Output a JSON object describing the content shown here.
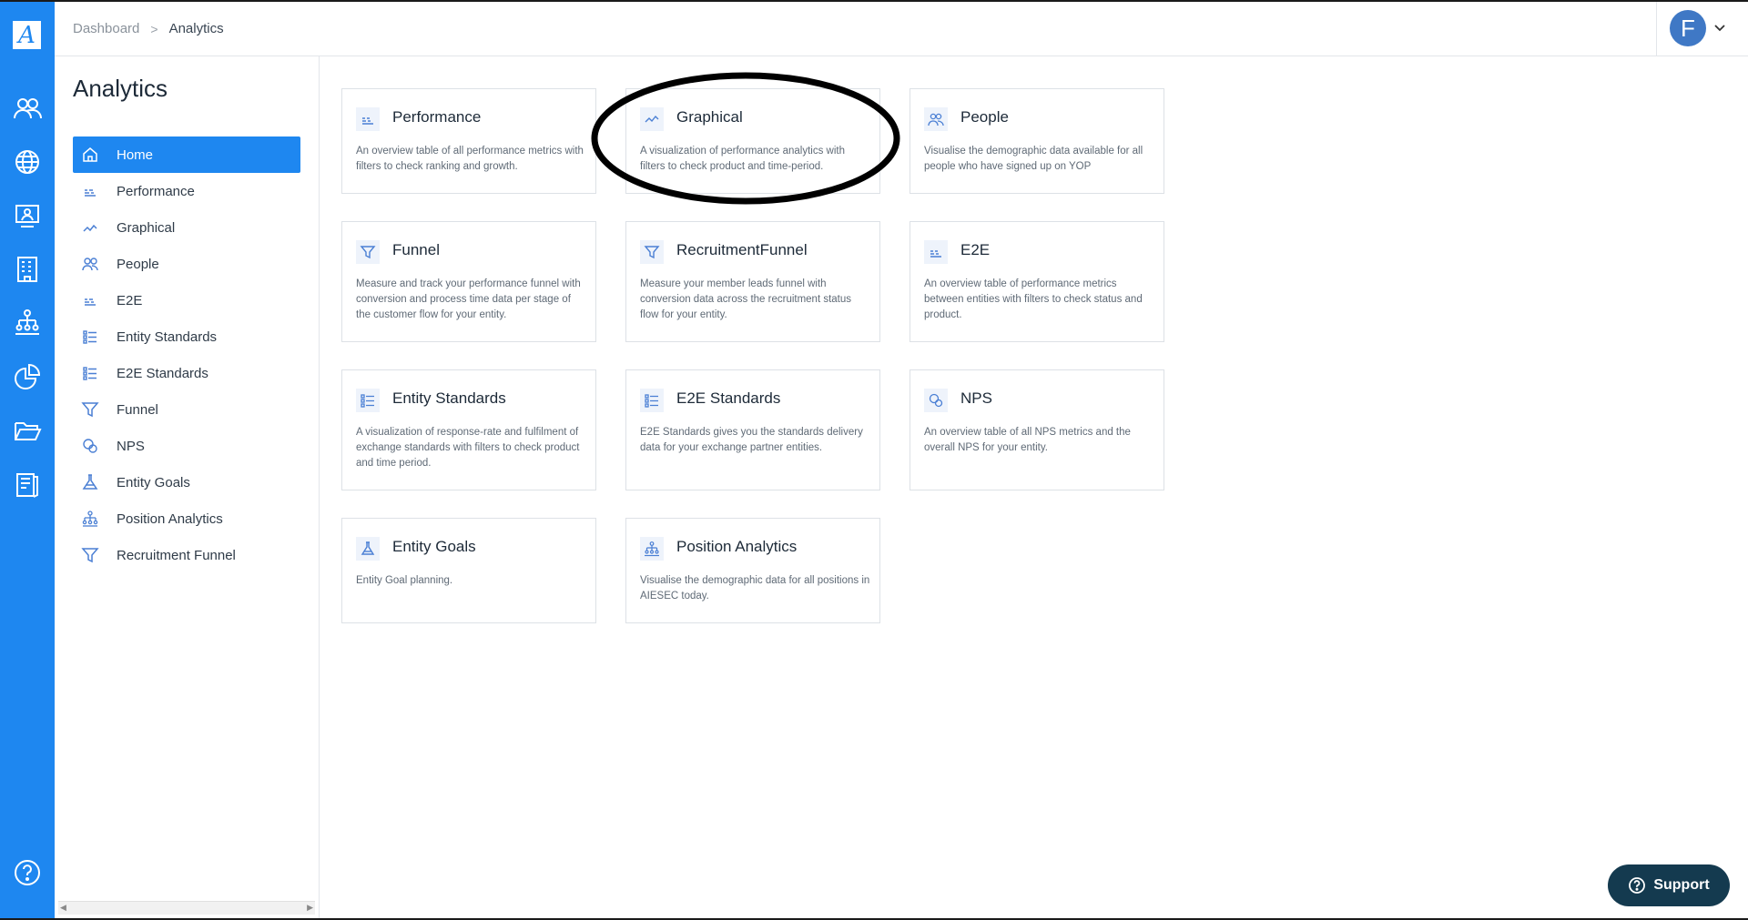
{
  "brand": {
    "logo_letter": "A",
    "accent": "#1e87f0",
    "rail_icon_color": "#ffffff"
  },
  "rail": {
    "items": [
      {
        "icon": "people-icon"
      },
      {
        "icon": "globe-icon"
      },
      {
        "icon": "monitor-user-icon"
      },
      {
        "icon": "building-icon"
      },
      {
        "icon": "org-chart-icon"
      },
      {
        "icon": "pie-chart-icon"
      },
      {
        "icon": "folder-open-icon"
      },
      {
        "icon": "report-icon"
      }
    ],
    "help_icon": "question-circle-icon"
  },
  "header": {
    "breadcrumb": {
      "parent": "Dashboard",
      "separator": ">",
      "current": "Analytics"
    },
    "user": {
      "avatar_letter": "F",
      "avatar_color": "#3f78c5"
    }
  },
  "sidebar": {
    "title": "Analytics",
    "items": [
      {
        "label": "Home",
        "icon": "home-icon",
        "active": true
      },
      {
        "label": "Performance",
        "icon": "performance-icon"
      },
      {
        "label": "Graphical",
        "icon": "graph-line-icon"
      },
      {
        "label": "People",
        "icon": "people-icon"
      },
      {
        "label": "E2E",
        "icon": "performance-icon"
      },
      {
        "label": "Entity Standards",
        "icon": "list-check-icon"
      },
      {
        "label": "E2E Standards",
        "icon": "list-check-icon"
      },
      {
        "label": "Funnel",
        "icon": "funnel-icon"
      },
      {
        "label": "NPS",
        "icon": "nps-icon"
      },
      {
        "label": "Entity Goals",
        "icon": "flask-icon"
      },
      {
        "label": "Position Analytics",
        "icon": "org-chart-icon"
      },
      {
        "label": "Recruitment Funnel",
        "icon": "funnel-icon"
      }
    ]
  },
  "cards": [
    {
      "title": "Performance",
      "icon": "performance-icon",
      "desc": "An overview table of all performance metrics with filters to check ranking and growth."
    },
    {
      "title": "Graphical",
      "icon": "graph-line-icon",
      "desc": "A visualization of performance analytics with filters to check product and time-period."
    },
    {
      "title": "People",
      "icon": "people-icon",
      "desc": "Visualise the demographic data available for all people who have signed up on YOP"
    },
    {
      "title": "Funnel",
      "icon": "funnel-icon",
      "desc": "Measure and track your performance funnel with conversion and process time data per stage of the customer flow for your entity."
    },
    {
      "title": "RecruitmentFunnel",
      "icon": "funnel-icon",
      "desc": "Measure your member leads funnel with conversion data across the recruitment status flow for your entity."
    },
    {
      "title": "E2E",
      "icon": "performance-icon",
      "desc": "An overview table of performance metrics between entities with filters to check status and product."
    },
    {
      "title": "Entity Standards",
      "icon": "list-check-icon",
      "desc": "A visualization of response-rate and fulfilment of exchange standards with filters to check product and time period."
    },
    {
      "title": "E2E Standards",
      "icon": "list-check-icon",
      "desc": "E2E Standards gives you the standards delivery data for your exchange partner entities."
    },
    {
      "title": "NPS",
      "icon": "nps-icon",
      "desc": "An overview table of all NPS metrics and the overall NPS for your entity."
    },
    {
      "title": "Entity Goals",
      "icon": "flask-icon",
      "desc": "Entity Goal planning."
    },
    {
      "title": "Position Analytics",
      "icon": "org-chart-icon",
      "desc": "Visualise the demographic data for all positions in AIESEC today."
    }
  ],
  "support": {
    "label": "Support",
    "icon": "question-circle-icon",
    "color": "#143a4f"
  }
}
